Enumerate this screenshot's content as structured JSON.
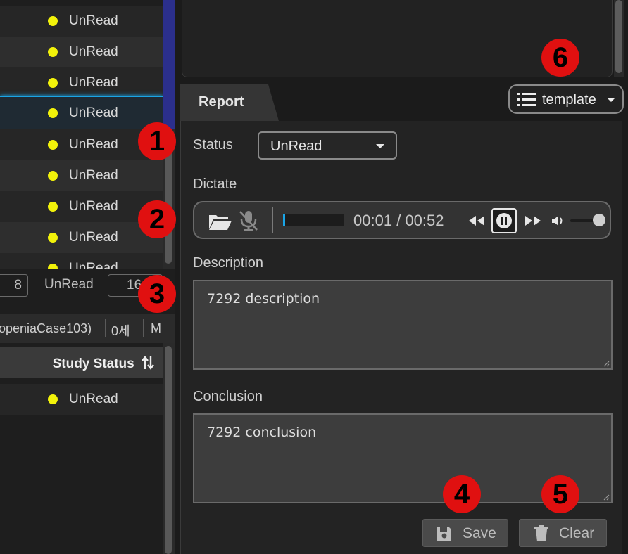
{
  "worklist": {
    "rows": [
      {
        "status": "UnRead"
      },
      {
        "status": "UnRead"
      },
      {
        "status": "UnRead"
      },
      {
        "status": "UnRead"
      },
      {
        "status": "UnRead"
      },
      {
        "status": "UnRead"
      },
      {
        "status": "UnRead"
      },
      {
        "status": "UnRead"
      },
      {
        "status": "UnRead"
      }
    ],
    "selected_index": 3,
    "status_color": "#f2f20a",
    "selection_color": "#1aa5e6"
  },
  "counts": {
    "left_value": "8",
    "unread_label": "UnRead",
    "unread_value": "16"
  },
  "patient_bar": {
    "name": "openiaCase103)",
    "age": "0세",
    "sex": "M"
  },
  "study_table": {
    "header": "Study Status",
    "sort_icon": "sort-icon",
    "rows": [
      {
        "status": "UnRead"
      }
    ]
  },
  "report": {
    "tab_label": "Report",
    "template_label": "template",
    "status_label": "Status",
    "status_value": "UnRead",
    "dictate_label": "Dictate",
    "player": {
      "current_time": "00:01",
      "time_separator": "/",
      "total_time": "00:52",
      "progress_fraction": 0.02,
      "volume_fraction": 0.9
    },
    "description_label": "Description",
    "description_value": "7292 description",
    "conclusion_label": "Conclusion",
    "conclusion_value": "7292 conclusion",
    "save_label": "Save",
    "clear_label": "Clear"
  },
  "annotations": [
    "1",
    "2",
    "3",
    "4",
    "5",
    "6"
  ],
  "colors": {
    "badge": "#e01010",
    "accent": "#1aa5e6",
    "panel_bg": "#232323"
  }
}
